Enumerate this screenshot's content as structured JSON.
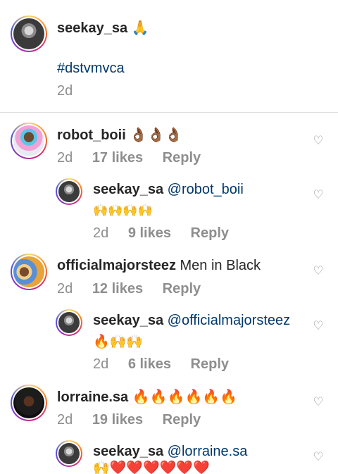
{
  "caption": {
    "username": "seekay_sa",
    "emoji": "🙏",
    "hashtag": "#dstvmvca",
    "time": "2d"
  },
  "comments": [
    {
      "username": "robot_boii",
      "text": "👌🏾👌🏾👌🏾",
      "time": "2d",
      "likes": "17 likes",
      "reply": "Reply",
      "replies": [
        {
          "username": "seekay_sa",
          "mention": "@robot_boii",
          "text": "🙌🙌🙌🙌",
          "time": "2d",
          "likes": "9 likes",
          "reply": "Reply"
        }
      ]
    },
    {
      "username": "officialmajorsteez",
      "text": "Men in Black",
      "time": "2d",
      "likes": "12 likes",
      "reply": "Reply",
      "replies": [
        {
          "username": "seekay_sa",
          "mention": "@officialmajorsteez",
          "text": "🔥🙌🙌",
          "time": "2d",
          "likes": "6 likes",
          "reply": "Reply"
        }
      ]
    },
    {
      "username": "lorraine.sa",
      "text": "🔥🔥🔥🔥🔥🔥",
      "time": "2d",
      "likes": "19 likes",
      "reply": "Reply",
      "replies": [
        {
          "username": "seekay_sa",
          "mention": "@lorraine.sa",
          "text": "🙌❤️❤️❤️❤️❤️❤️"
        }
      ]
    }
  ],
  "icons": {
    "like": "heart-outline-icon"
  },
  "colors": {
    "link": "#00376b",
    "meta": "#8e8e8e",
    "text": "#262626"
  }
}
